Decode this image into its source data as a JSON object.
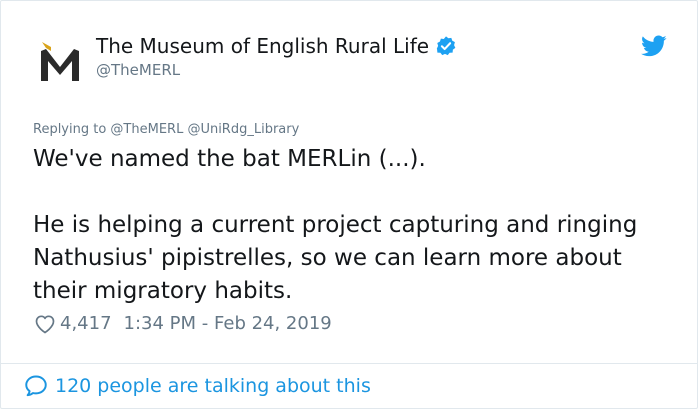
{
  "tweet": {
    "author": {
      "display_name": "The Museum of English Rural Life",
      "handle": "@TheMERL",
      "verified": true,
      "avatar_icon": "merl-logo-icon"
    },
    "replying_to": "Replying to @TheMERL @UniRdg_Library",
    "text": "We've named the bat MERLin (...).\n\nHe is helping a current project capturing and ringing Nathusius' pipistrelles, so we can learn more about their migratory habits.",
    "likes": "4,417",
    "timestamp": "1:34 PM - Feb 24, 2019",
    "talking_about": "120 people are talking about this"
  },
  "icons": {
    "brand": "twitter-bird-icon",
    "verified": "verified-badge-icon",
    "like": "heart-icon",
    "conversation": "speech-bubble-icon"
  },
  "colors": {
    "brand_blue": "#1da1f2",
    "link_blue": "#1b95e0",
    "secondary_text": "#657786",
    "primary_text": "#14171a",
    "logo_gold": "#d9a31a"
  }
}
